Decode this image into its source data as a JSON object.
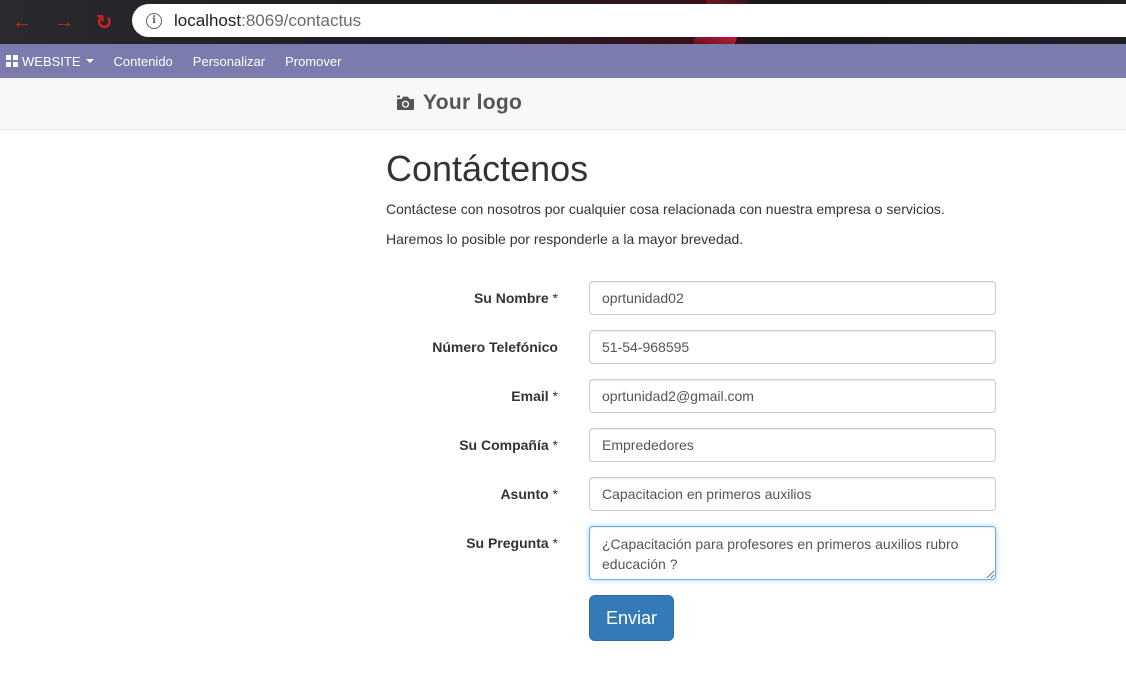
{
  "browser": {
    "url_host": "localhost",
    "url_path": ":8069/contactus"
  },
  "admin_bar": {
    "website_label": "WEBSITE",
    "items": [
      "Contenido",
      "Personalizar",
      "Promover"
    ]
  },
  "header": {
    "logo_text": "Your logo"
  },
  "page": {
    "title": "Contáctenos",
    "intro_1": "Contáctese con nosotros por cualquier cosa relacionada con nuestra empresa o servicios.",
    "intro_2": "Haremos lo posible por responderle a la mayor brevedad."
  },
  "form": {
    "name": {
      "label": "Su Nombre",
      "required": "*",
      "value": "oprtunidad02"
    },
    "phone": {
      "label": "Número Telefónico",
      "value": "51-54-968595"
    },
    "email": {
      "label": "Email",
      "required": "*",
      "value": "oprtunidad2@gmail.com"
    },
    "company": {
      "label": "Su Compañía",
      "required": "*",
      "value": "Emprededores"
    },
    "subject": {
      "label": "Asunto",
      "required": "*",
      "value": "Capacitacion en primeros auxilios"
    },
    "question": {
      "label": "Su Pregunta",
      "required": "*",
      "value": "¿Capacitación para profesores en primeros auxilios rubro educación ?"
    },
    "submit_label": "Enviar"
  },
  "colors": {
    "admin_bar": "#7c7bad",
    "primary_button": "#337ab7",
    "nav_icons": "#d61f1f"
  }
}
